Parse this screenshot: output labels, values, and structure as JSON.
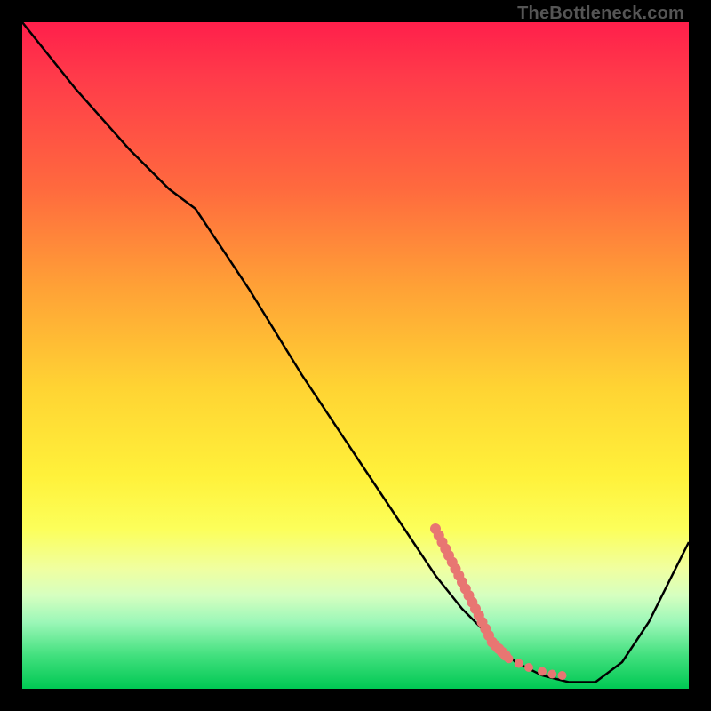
{
  "watermark": "TheBottleneck.com",
  "chart_data": {
    "type": "line",
    "title": "",
    "xlabel": "",
    "ylabel": "",
    "xlim": [
      0,
      100
    ],
    "ylim": [
      0,
      100
    ],
    "series": [
      {
        "name": "curve",
        "x": [
          0,
          8,
          16,
          22,
          26,
          34,
          42,
          50,
          58,
          62,
          66,
          70,
          74,
          78,
          82,
          86,
          90,
          94,
          100
        ],
        "y": [
          100,
          90,
          81,
          75,
          72,
          60,
          47,
          35,
          23,
          17,
          12,
          8,
          4,
          2,
          1,
          1,
          4,
          10,
          22
        ]
      }
    ],
    "highlight_dots": {
      "name": "dotted-segment",
      "color": "#e87672",
      "points": [
        {
          "x": 62,
          "y": 24
        },
        {
          "x": 62.5,
          "y": 23
        },
        {
          "x": 63,
          "y": 22
        },
        {
          "x": 63.5,
          "y": 21
        },
        {
          "x": 64,
          "y": 20
        },
        {
          "x": 64.5,
          "y": 19
        },
        {
          "x": 65,
          "y": 18
        },
        {
          "x": 65.5,
          "y": 17
        },
        {
          "x": 66,
          "y": 16
        },
        {
          "x": 66.5,
          "y": 15
        },
        {
          "x": 67,
          "y": 14
        },
        {
          "x": 67.5,
          "y": 13
        },
        {
          "x": 68,
          "y": 12
        },
        {
          "x": 68.5,
          "y": 11
        },
        {
          "x": 69,
          "y": 10
        },
        {
          "x": 69.5,
          "y": 9
        },
        {
          "x": 70,
          "y": 8
        },
        {
          "x": 70.5,
          "y": 7
        },
        {
          "x": 71,
          "y": 6.5
        },
        {
          "x": 71.5,
          "y": 6
        },
        {
          "x": 72,
          "y": 5.5
        },
        {
          "x": 72.5,
          "y": 5
        },
        {
          "x": 73,
          "y": 4.5
        },
        {
          "x": 74.5,
          "y": 3.8
        },
        {
          "x": 76,
          "y": 3.2
        },
        {
          "x": 78,
          "y": 2.6
        },
        {
          "x": 79.5,
          "y": 2.2
        },
        {
          "x": 81,
          "y": 2.0
        }
      ]
    }
  }
}
